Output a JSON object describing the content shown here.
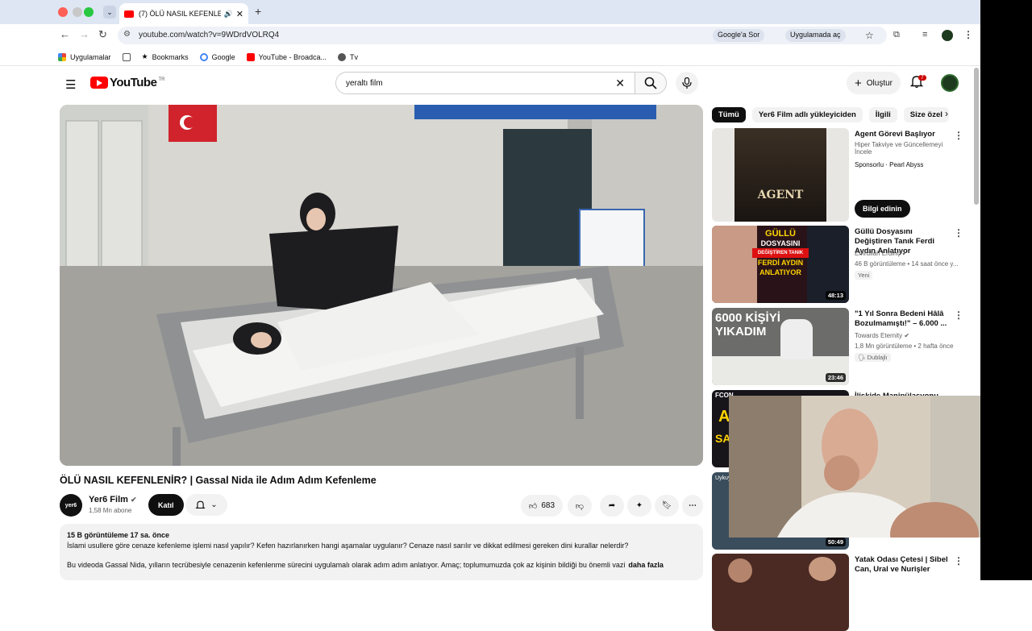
{
  "browser": {
    "tab_title": "(7) ÖLÜ NASIL KEFENLEN",
    "url": "youtube.com/watch?v=9WDrdVOLRQ4",
    "google_search_chip": "Google'a Sor",
    "open_in_app_chip": "Uygulamada aç",
    "bookmarks": [
      "Uygulamalar",
      "Bookmarks",
      "Google",
      "YouTube - Broadca...",
      "Tv"
    ]
  },
  "yt_header": {
    "logo_text": "YouTube",
    "region": "TR",
    "search_value": "yeraltı film",
    "create_label": "Oluştur",
    "notification_count": "7"
  },
  "video": {
    "title": "ÖLÜ NASIL KEFENLENİR? | Gassal Nida ile Adım Adım Kefenleme",
    "channel_logo_text": "yer6",
    "channel": "Yer6 Film",
    "subscribers": "1,58 Mn abone",
    "join_label": "Katıl",
    "likes": "683",
    "views_and_date": "15 B görüntüleme  17 sa. önce",
    "description_line1": "İslami usullere göre cenaze kefenleme işlemi nasıl yapılır? Kefen hazırlanırken hangi aşamalar uygulanır? Cenaze nasıl sarılır ve dikkat edilmesi gereken dini kurallar nelerdir?",
    "description_line2": "Bu videoda Gassal Nida, yılların tecrübesiyle cenazenin kefenlenme sürecini uygulamalı olarak adım adım anlatıyor. Amaç; toplumumuzda çok az kişinin bildiği bu önemli vazi",
    "more_label": "daha fazla"
  },
  "sidebar": {
    "chips": [
      "Tümü",
      "Yer6 Film adlı yükleyiciden",
      "İlgili",
      "Size özel"
    ],
    "recommendations": [
      {
        "title": "Agent Görevi Başlıyor",
        "subtitle": "Hiper Takviye ve Güncellemeyi İncele",
        "channel": "Sponsorlu · Pearl Abyss",
        "cta": "Bilgi edinin",
        "thumb_text": "AGENT"
      },
      {
        "title": "Güllü Dosyasını Değiştiren Tanık  Ferdi Aydın Anlatıyor",
        "channel": "Emrullah Erdinç",
        "meta": "46 B görüntüleme • 14 saat önce y...",
        "tag": "Yeni",
        "duration": "48:13",
        "thumb_text": [
          "GÜLLÜ",
          "DOSYASINI",
          "DEĞİŞTİREN TANIK",
          "FERDİ AYDIN",
          "ANLATIYOR"
        ]
      },
      {
        "title": "\"1 Yıl Sonra Bedeni Hâlâ Bozulmamıştı!\" – 6.000 ...",
        "channel": "Towards Eternity",
        "meta": "1,8 Mn görüntüleme • 2 hafta önce",
        "tag": "Dublajlı",
        "duration": "23:46",
        "thumb_text": [
          "6000 KİŞİYİ",
          "YIKADIM"
        ]
      },
      {
        "title": "İlişkide Manipülasyonu",
        "thumb_text": "FCON"
      },
      {
        "title": "",
        "duration": "50:49",
        "thumb_text": "Uykuy"
      },
      {
        "title": "Yatak Odası Çetesi | Sibel Can, Ural ve Nurişler"
      }
    ]
  }
}
